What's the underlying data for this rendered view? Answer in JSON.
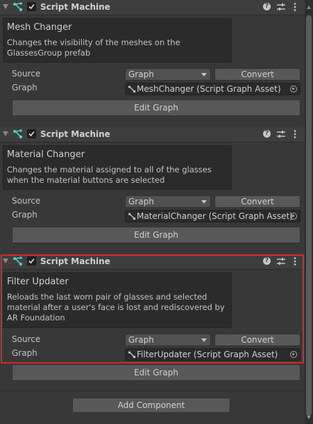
{
  "colors": {
    "highlight": "#e0242c",
    "graph_icon": "#4fd0c2"
  },
  "components": [
    {
      "title": "Script Machine",
      "description_title": "Mesh Changer",
      "description": "Changes the visibility of the meshes on the GlassesGroup prefab",
      "source_label": "Source",
      "source_value": "Graph",
      "convert_label": "Convert",
      "graph_label": "Graph",
      "graph_value": "MeshChanger (Script Graph Asset)",
      "edit_label": "Edit Graph"
    },
    {
      "title": "Script Machine",
      "description_title": "Material Changer",
      "description": "Changes the material assigned to all of the glasses when the material buttons are selected",
      "source_label": "Source",
      "source_value": "Graph",
      "convert_label": "Convert",
      "graph_label": "Graph",
      "graph_value": "MaterialChanger (Script Graph Asset)",
      "edit_label": "Edit Graph"
    },
    {
      "title": "Script Machine",
      "description_title": "Filter Updater",
      "description": "Reloads the last worn pair of glasses and selected material after a user's face is lost and rediscovered by AR Foundation",
      "source_label": "Source",
      "source_value": "Graph",
      "convert_label": "Convert",
      "graph_label": "Graph",
      "graph_value": "FilterUpdater (Script Graph Asset)",
      "edit_label": "Edit Graph"
    }
  ],
  "add_component_label": "Add Component"
}
